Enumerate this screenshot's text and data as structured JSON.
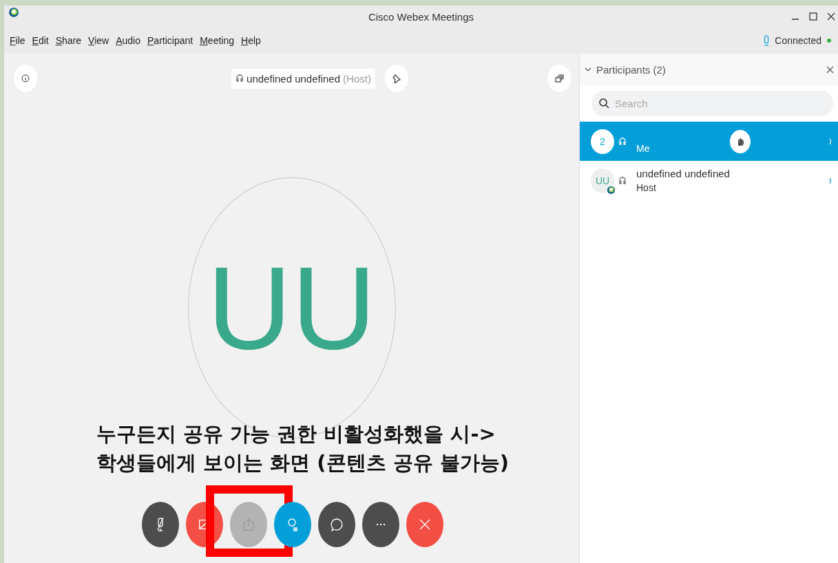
{
  "window": {
    "title": "Cisco Webex Meetings"
  },
  "menu": [
    "File",
    "Edit",
    "Share",
    "View",
    "Audio",
    "Participant",
    "Meeting",
    "Help"
  ],
  "connection": {
    "label": "Connected",
    "connected": true
  },
  "stage": {
    "speaker": "undefined undefined",
    "speaker_role": "(Host)",
    "avatar": "UU"
  },
  "controls": [
    {
      "kind": "mic",
      "disabled": false,
      "highlighted": false
    },
    {
      "kind": "video",
      "disabled": false,
      "highlighted": false
    },
    {
      "kind": "share",
      "disabled": true,
      "highlighted": true
    },
    {
      "kind": "participants",
      "disabled": false,
      "highlighted": false
    },
    {
      "kind": "chat",
      "disabled": false,
      "highlighted": false
    },
    {
      "kind": "more",
      "disabled": false,
      "highlighted": false
    },
    {
      "kind": "leave",
      "disabled": false,
      "highlighted": false
    }
  ],
  "panel": {
    "title": "Participants (2)",
    "search": {
      "placeholder": "Search"
    },
    "participants": [
      {
        "avatar": "2",
        "role": "Me",
        "selected": true,
        "hand_raised": true,
        "host": false
      },
      {
        "avatar": "UU",
        "name": "undefined undefined",
        "role": "Host",
        "selected": false,
        "hand_raised": false,
        "host": true
      }
    ]
  },
  "annotation": {
    "lines": [
      "누구든지 공유 가능 권한 비활성화했을 시->",
      "학생들에게 보이는 화면 (콘텐츠 공유 불가능)"
    ]
  }
}
